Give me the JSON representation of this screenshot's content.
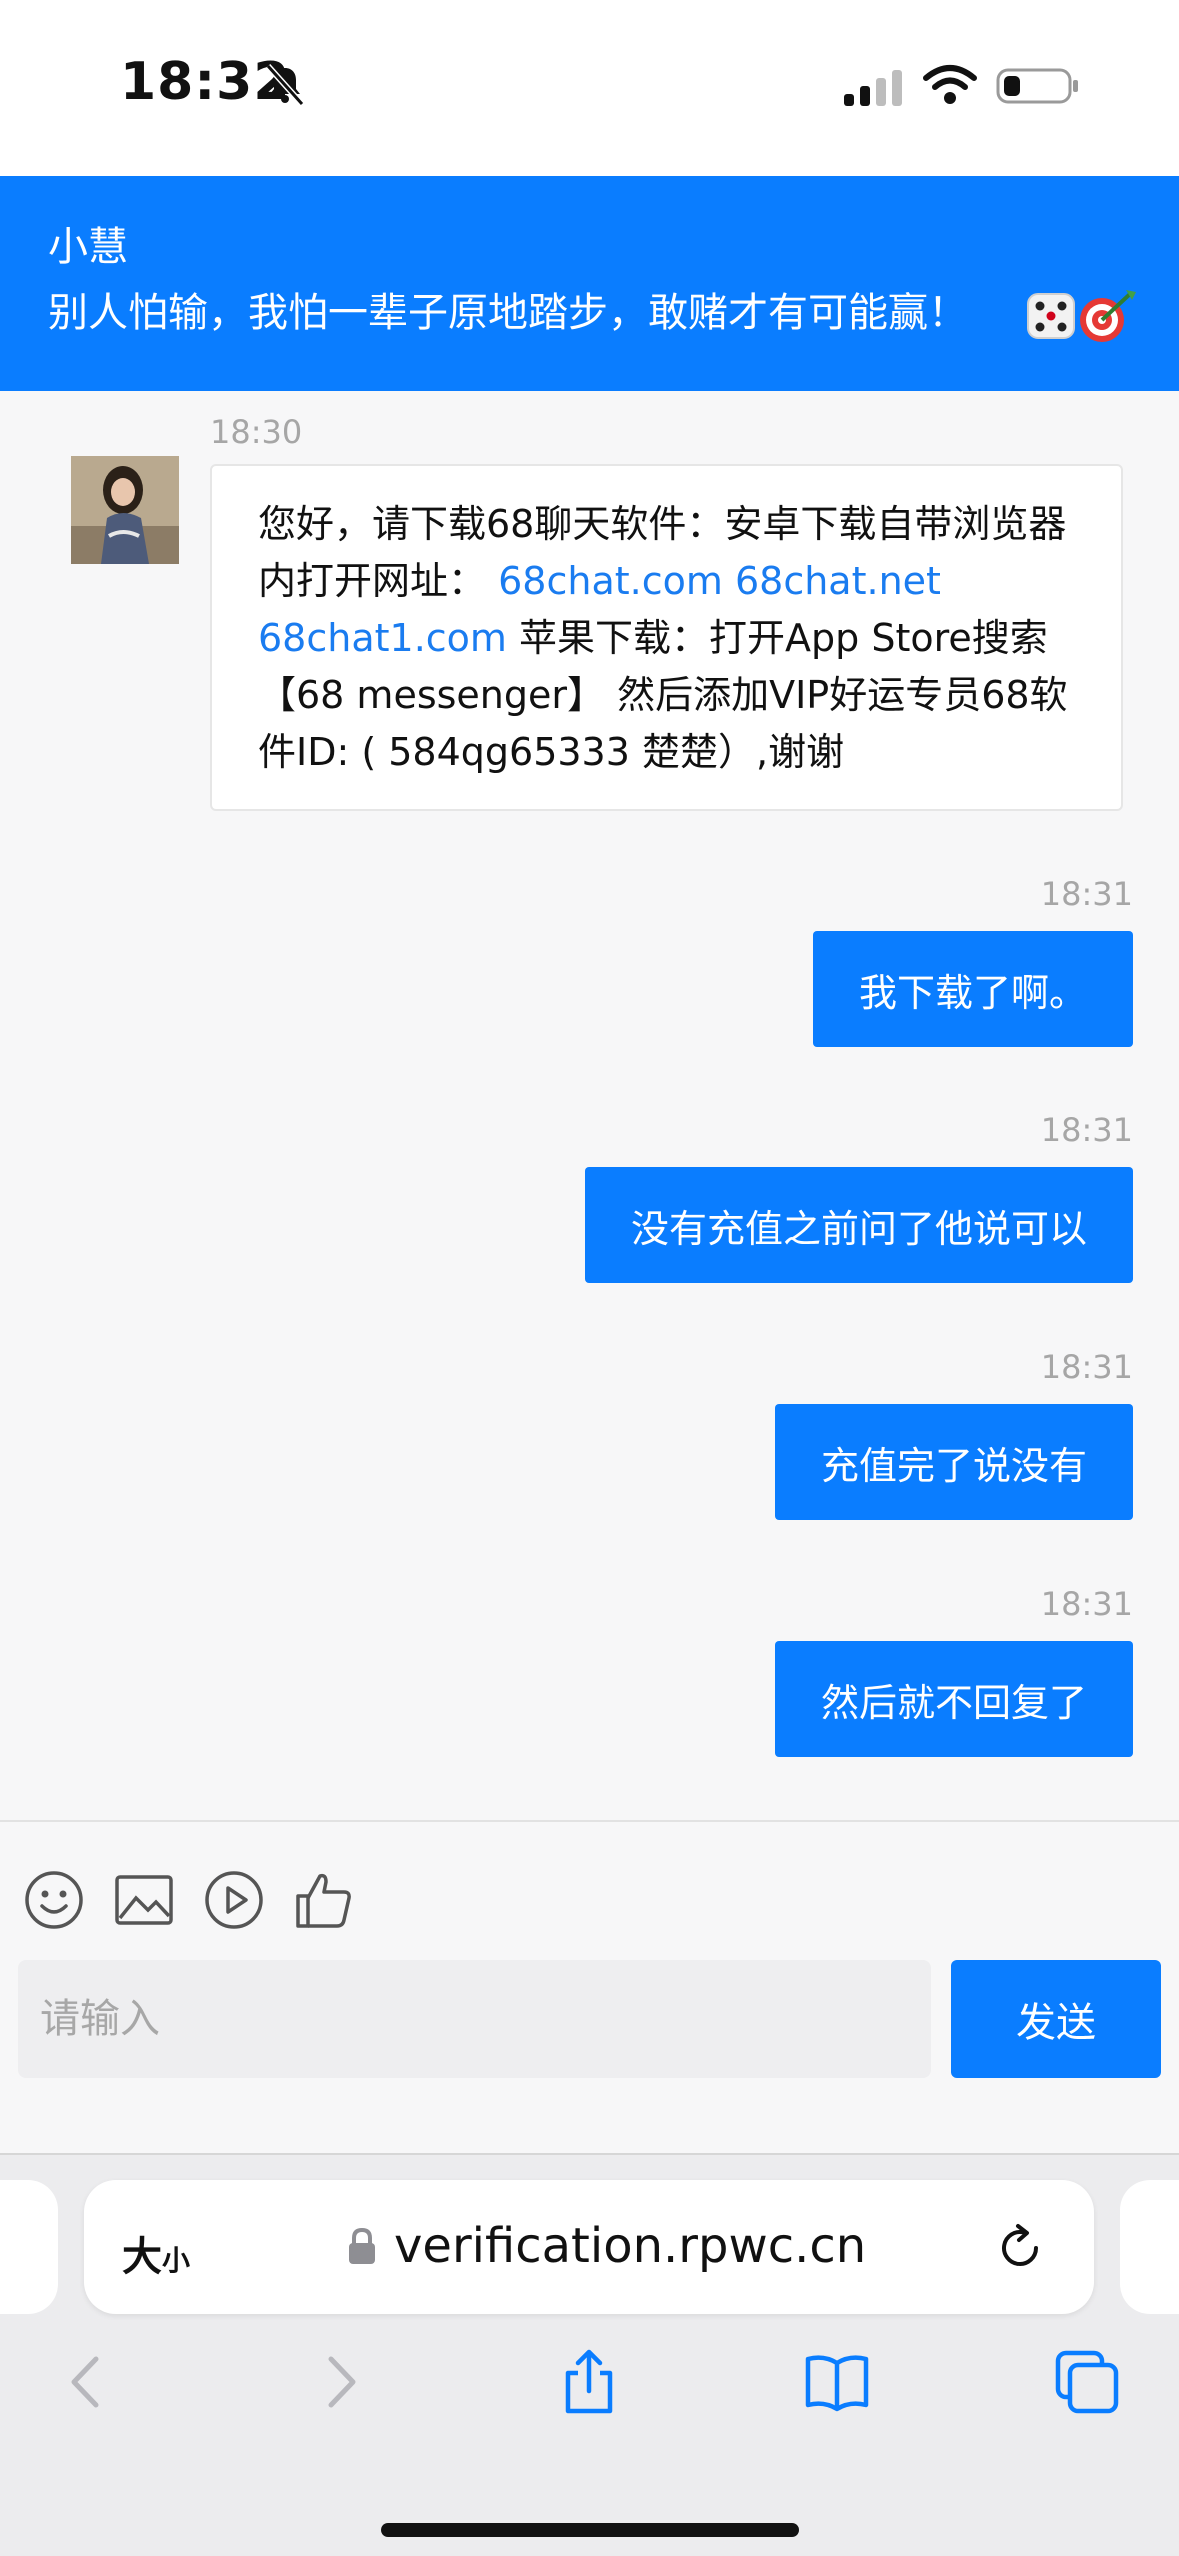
{
  "status_bar": {
    "time": "18:32"
  },
  "header": {
    "name": "小慧",
    "motto": "别人怕输，我怕一辈子原地踏步，敢赌才有可能赢！"
  },
  "messages": {
    "incoming": {
      "time": "18:30",
      "text_1": "您好，请下载68聊天软件：安卓下载自带浏览器内打开网址：",
      "link_1": "68chat.com",
      "link_2": "68chat.net",
      "link_3": "68chat1.com",
      "text_2": "苹果下载：打开App Store搜索【68 messenger】 然后添加VIP好运专员68软件ID: ( 584qg65333 楚楚）,谢谢"
    },
    "outgoing": [
      {
        "time": "18:31",
        "text": "我下载了啊。"
      },
      {
        "time": "18:31",
        "text": "没有充值之前问了他说可以"
      },
      {
        "time": "18:31",
        "text": "充值完了说没有"
      },
      {
        "time": "18:31",
        "text": "然后就不回复了"
      }
    ]
  },
  "composer": {
    "placeholder": "请输入",
    "send_label": "发送"
  },
  "browser": {
    "text_size_big": "大",
    "text_size_small": "小",
    "url": "verification.rpwc.cn"
  },
  "colors": {
    "accent": "#0a7dff",
    "link": "#1a7cf0"
  }
}
